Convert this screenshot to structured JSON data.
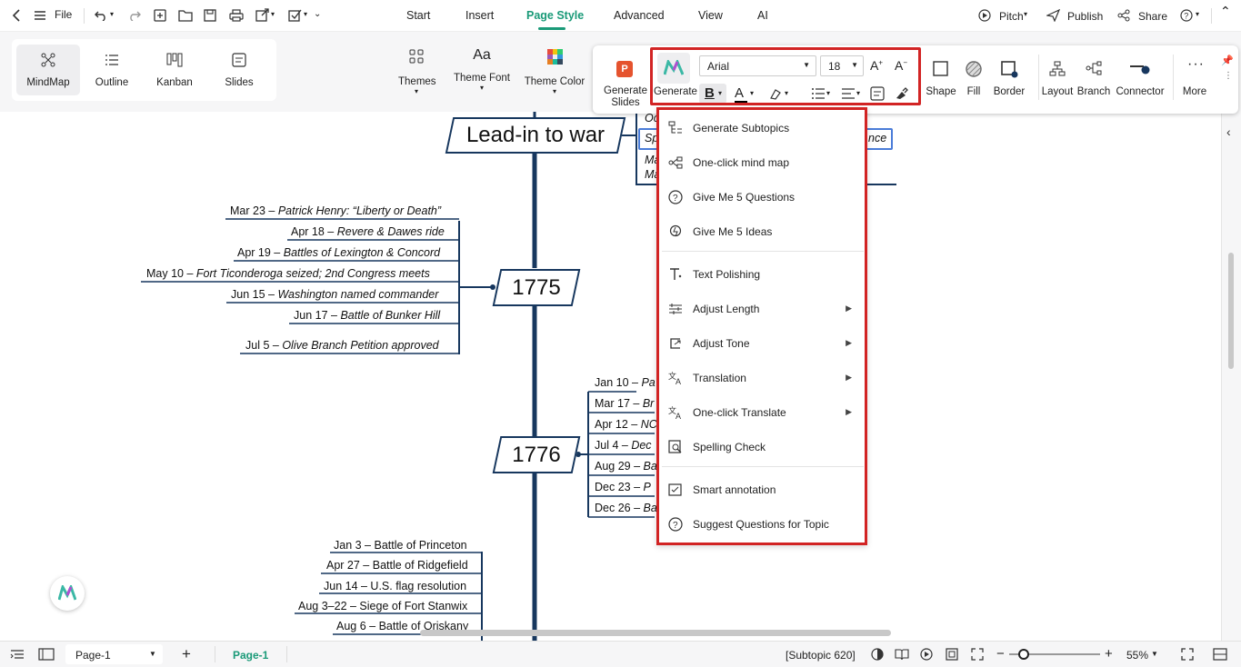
{
  "topbar": {
    "file": "File",
    "tabs": [
      "Start",
      "Insert",
      "Page Style",
      "Advanced",
      "View",
      "AI"
    ],
    "pitch": "Pitch",
    "publish": "Publish",
    "share": "Share"
  },
  "views": [
    "MindMap",
    "Outline",
    "Kanban",
    "Slides"
  ],
  "theme_buttons": [
    "Themes",
    "Theme Font",
    "Theme Color"
  ],
  "floatbar": {
    "generate_slides": "Generate Slides",
    "generate": "Generate",
    "font": "Arial",
    "size": "18",
    "bold": "B",
    "font_color": "A",
    "shape": "Shape",
    "fill": "Fill",
    "border": "Border",
    "layout": "Layout",
    "branch": "Branch",
    "connector": "Connector",
    "more": "More"
  },
  "ai_menu": {
    "group1": [
      "Generate Subtopics",
      "One-click mind map",
      "Give Me 5 Questions",
      "Give Me 5 Ideas"
    ],
    "group2": [
      "Text Polishing",
      "Adjust Length",
      "Adjust Tone",
      "Translation",
      "One-click Translate",
      "Spelling Check"
    ],
    "group3": [
      "Smart annotation",
      "Suggest Questions for Topic"
    ]
  },
  "canvas": {
    "main_topic": "Lead-in to war",
    "partial_top": [
      "Oc",
      "Sp",
      "Ma",
      "Ma"
    ],
    "partial_top_right": "nce",
    "year1": "1775",
    "year2": "1776",
    "events_1775": [
      {
        "date": "Mar 23 – ",
        "text": "Patrick Henry: “Liberty or Death”"
      },
      {
        "date": "Apr 18 – ",
        "text": "Revere & Dawes ride"
      },
      {
        "date": "Apr 19 – ",
        "text": "Battles of Lexington & Concord"
      },
      {
        "date": "May 10 – ",
        "text": "Fort Ticonderoga seized; 2nd Congress meets"
      },
      {
        "date": "Jun 15 – ",
        "text": "Washington named commander"
      },
      {
        "date": "Jun 17 – ",
        "text": "Battle of Bunker Hill"
      },
      {
        "date": "Jul 5 – ",
        "text": "Olive Branch Petition approved"
      }
    ],
    "events_1776": [
      {
        "date": "Jan 10 – ",
        "text": "Pa"
      },
      {
        "date": "Mar 17 – ",
        "text": "Br"
      },
      {
        "date": "Apr 12 – ",
        "text": "NC"
      },
      {
        "date": "Jul 4 – ",
        "text": "Dec"
      },
      {
        "date": "Aug 29 – ",
        "text": "Ba"
      },
      {
        "date": "Dec 23 – ",
        "text": "P"
      },
      {
        "date": "Dec 26 – ",
        "text": "Ba"
      }
    ],
    "events_1777": [
      "Jan 3 – Battle of Princeton",
      "Apr 27 – Battle of Ridgefield",
      "Jun 14 – U.S. flag resolution",
      "Aug 3–22 – Siege of Fort Stanwix",
      "Aug 6 – Battle of Oriskany"
    ]
  },
  "status": {
    "page_select": "Page-1",
    "page_tab": "Page-1",
    "topic_count": "[Subtopic 620]",
    "zoom": "55%"
  },
  "colors": {
    "accent": "#1a9a78",
    "highlight": "#d22424",
    "branch": "#17375e"
  }
}
